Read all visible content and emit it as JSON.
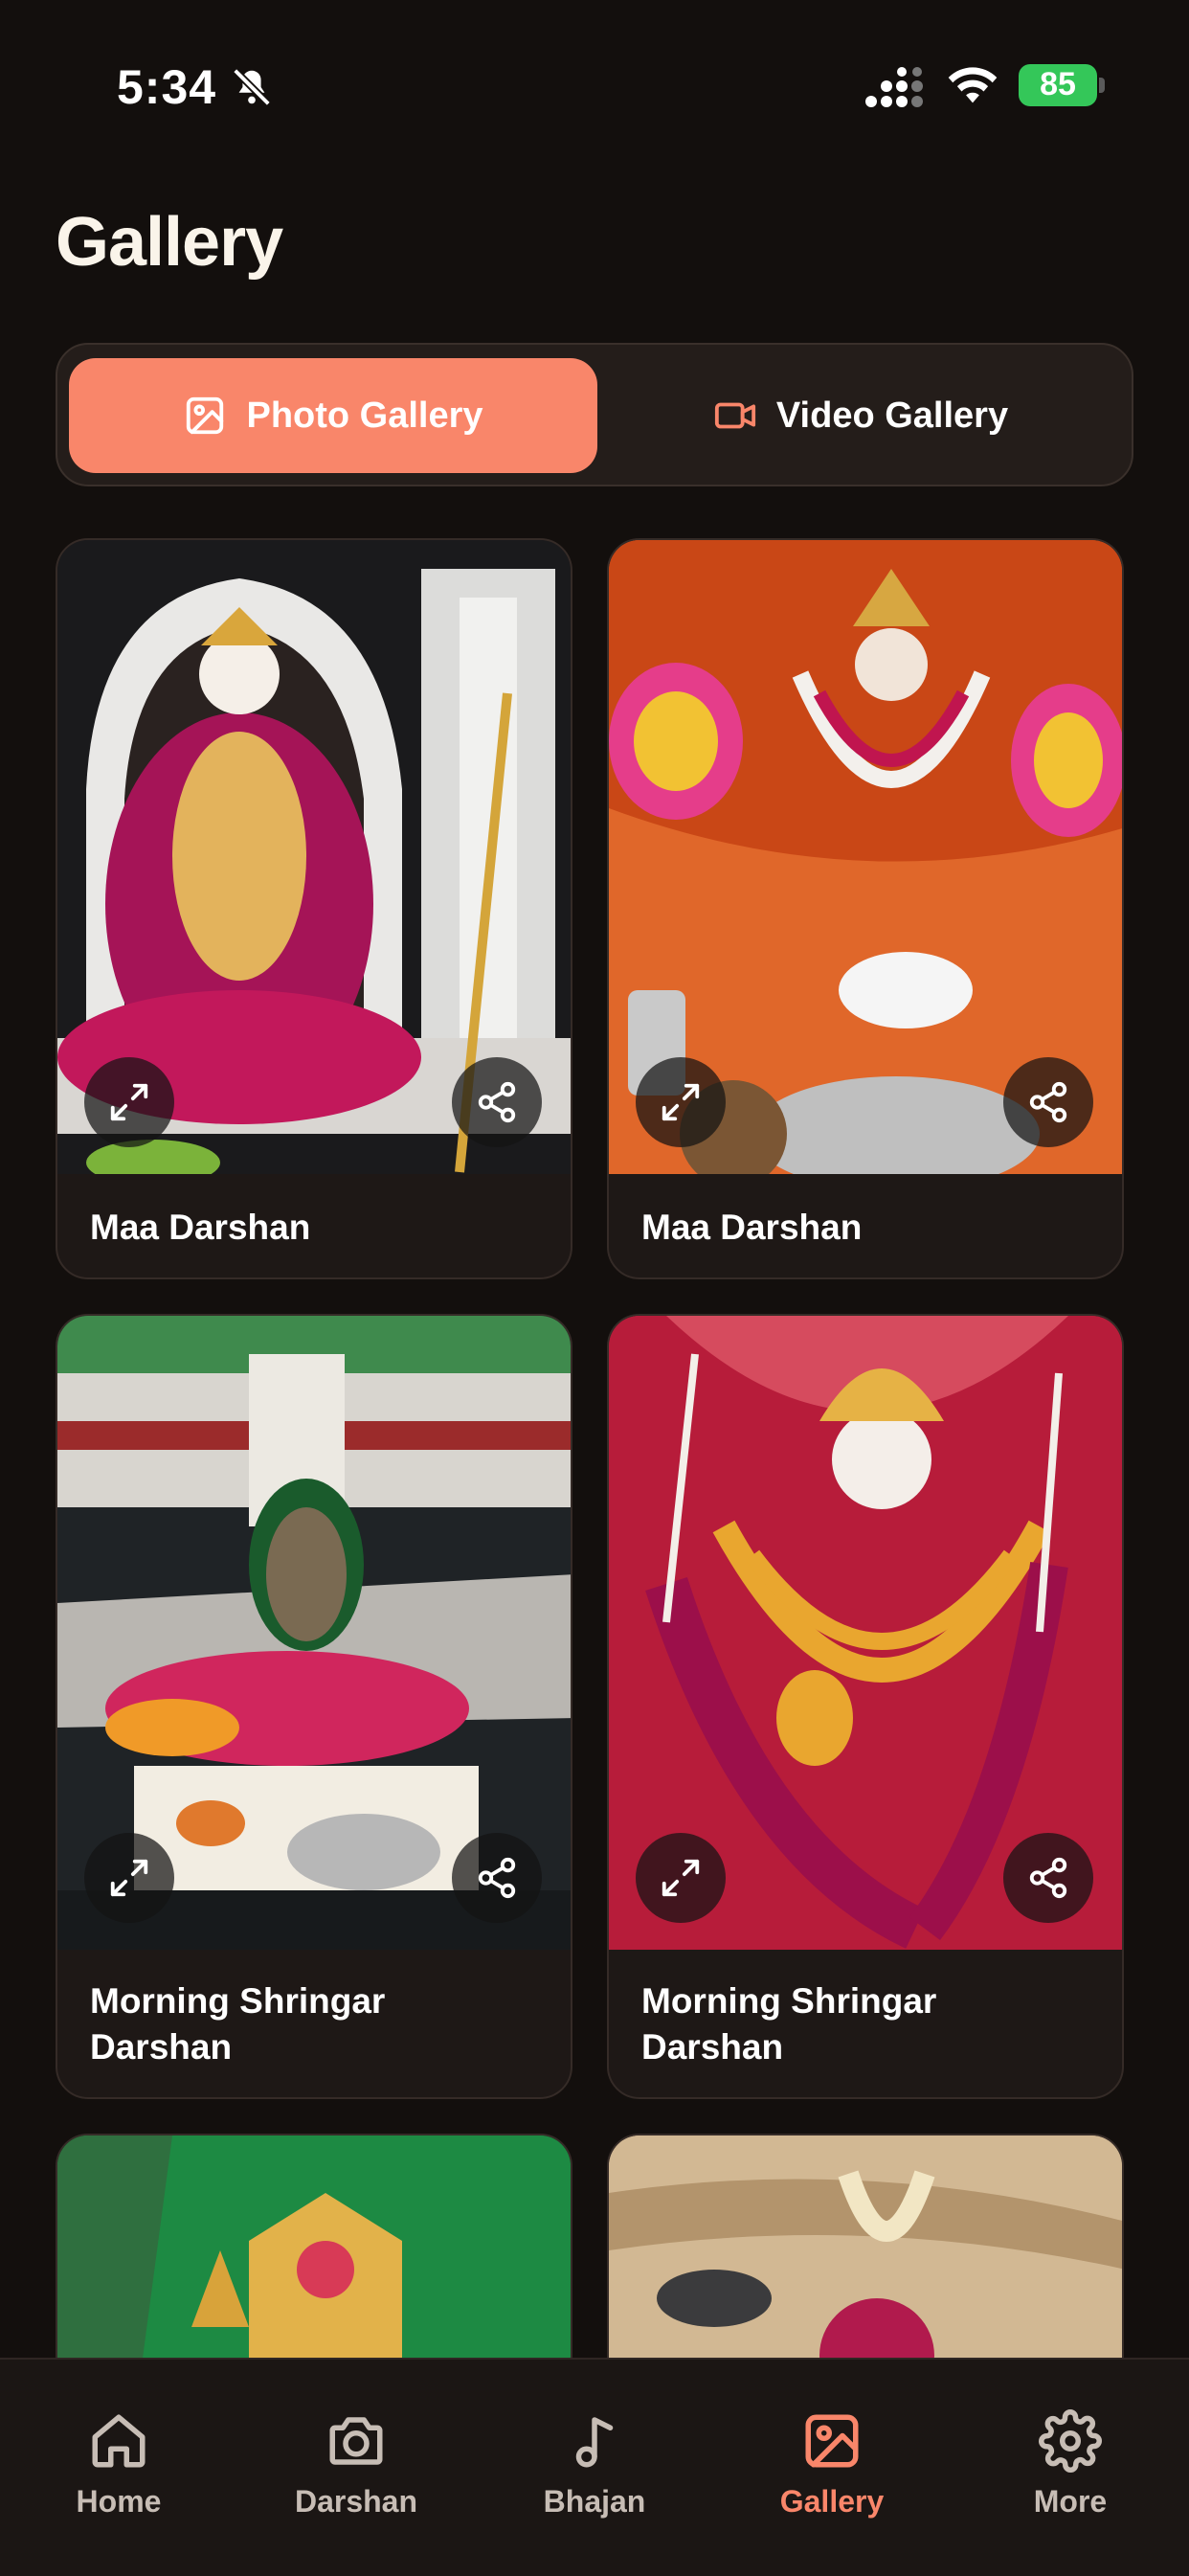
{
  "status_bar": {
    "time": "5:34",
    "battery": "85"
  },
  "page_title": "Gallery",
  "segmented": {
    "photo_label": "Photo Gallery",
    "video_label": "Video Gallery"
  },
  "gallery": {
    "items": [
      {
        "title": "Maa Darshan"
      },
      {
        "title": "Maa Darshan"
      },
      {
        "title": "Morning Shringar Darshan"
      },
      {
        "title": "Morning Shringar Darshan"
      }
    ]
  },
  "tab_bar": {
    "items": [
      {
        "label": "Home",
        "icon": "home-icon"
      },
      {
        "label": "Darshan",
        "icon": "camera-icon"
      },
      {
        "label": "Bhajan",
        "icon": "music-note-icon"
      },
      {
        "label": "Gallery",
        "icon": "image-icon"
      },
      {
        "label": "More",
        "icon": "gear-icon"
      }
    ],
    "active": "Gallery"
  },
  "colors": {
    "accent": "#f9866a",
    "background": "#130f0d",
    "card": "#1e1816",
    "battery": "#34c759"
  }
}
